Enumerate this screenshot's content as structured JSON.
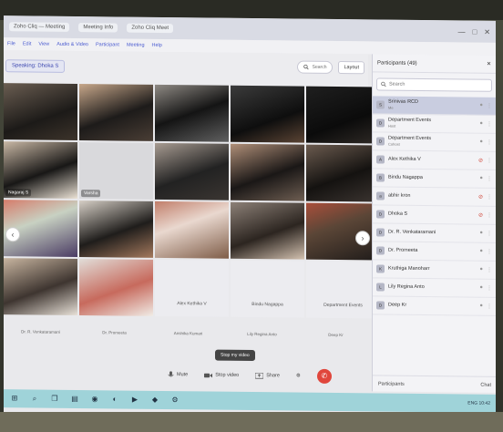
{
  "window": {
    "tabs": [
      "Zoho Cliq — Meeting",
      "Meeting Info",
      "Zoho Cliq Meet"
    ],
    "min_label": "—",
    "max_label": "□",
    "close_label": "✕"
  },
  "menu": [
    "File",
    "Edit",
    "View",
    "Audio & Video",
    "Participant",
    "Meeting",
    "Help"
  ],
  "toolbar": {
    "speaking": "Speaking: Dhoka S",
    "search_placeholder": "Search",
    "layout_label": "Layout"
  },
  "tiles": [
    {
      "name": "",
      "tone": "t1"
    },
    {
      "name": "",
      "tone": "t2"
    },
    {
      "name": "",
      "tone": "t3"
    },
    {
      "name": "",
      "tone": "t4"
    },
    {
      "name": "",
      "tone": "t5"
    },
    {
      "name": "Nagaraj S",
      "tone": "t6"
    },
    {
      "name": "Varsha",
      "tone": "t7"
    },
    {
      "name": "",
      "tone": "t8"
    },
    {
      "name": "",
      "tone": "t9"
    },
    {
      "name": "",
      "tone": "t10"
    },
    {
      "name": "",
      "tone": "t11"
    },
    {
      "name": "",
      "tone": "t12"
    },
    {
      "name": "",
      "tone": "t13"
    },
    {
      "name": "",
      "tone": "t14"
    },
    {
      "name": "",
      "tone": "t15"
    },
    {
      "name": "",
      "tone": "t16"
    },
    {
      "name": "",
      "tone": "t17"
    },
    {
      "name": "Alex Kethika V",
      "tone": "empty"
    },
    {
      "name": "Bindu Nagappa",
      "tone": "empty"
    },
    {
      "name": "Department Events",
      "tone": "empty"
    }
  ],
  "bottom_names": [
    "Dr. R. Venkataramani",
    "Dr. Promeeta",
    "Anshika Kumari",
    "Lily Regina Anto",
    "Deep Kr"
  ],
  "stop_video_label": "Stop my video",
  "controls": {
    "mute": "Mute",
    "stop_video": "Stop video",
    "share": "Share",
    "leave_icon": "leave-call-icon"
  },
  "panel": {
    "title": "Participants (49)",
    "search_placeholder": "Search",
    "participants": [
      {
        "name": "Srinivas RCD",
        "sub": "Me",
        "initial": "S",
        "host": true,
        "mic": "on"
      },
      {
        "name": "Department Events",
        "sub": "Host",
        "initial": "D",
        "host": false,
        "mic": "on"
      },
      {
        "name": "Department Events",
        "sub": "Cohost",
        "initial": "D",
        "host": false,
        "mic": "on"
      },
      {
        "name": "Alex Kethika V",
        "sub": "",
        "initial": "A",
        "host": false,
        "mic": "off"
      },
      {
        "name": "Bindu Nagappa",
        "sub": "",
        "initial": "B",
        "host": false,
        "mic": "on"
      },
      {
        "name": "abhir kron",
        "sub": "",
        "initial": "a",
        "host": false,
        "mic": "off"
      },
      {
        "name": "Dhoka S",
        "sub": "",
        "initial": "D",
        "host": false,
        "mic": "off"
      },
      {
        "name": "Dr. R. Venkataramani",
        "sub": "",
        "initial": "D",
        "host": false,
        "mic": "on"
      },
      {
        "name": "Dr. Promeeta",
        "sub": "",
        "initial": "D",
        "host": false,
        "mic": "on"
      },
      {
        "name": "Kruthiga Manoharr",
        "sub": "",
        "initial": "K",
        "host": false,
        "mic": "on"
      },
      {
        "name": "Lily Regina Anto",
        "sub": "",
        "initial": "L",
        "host": false,
        "mic": "on"
      },
      {
        "name": "Deep Kr",
        "sub": "",
        "initial": "D",
        "host": false,
        "mic": "on"
      }
    ],
    "footer_left": "Participants",
    "footer_right": "Chat"
  },
  "taskbar": {
    "icons": [
      "windows-start-icon",
      "search-icon",
      "task-view-icon",
      "file-explorer-icon",
      "chrome-icon",
      "edge-icon",
      "media-icon",
      "zoho-icon",
      "settings-icon"
    ],
    "tray": "ENG 10:42"
  },
  "colors": {
    "accent": "#3b46b0",
    "leave": "#e0463c",
    "taskbar": "#9fd3d9"
  }
}
